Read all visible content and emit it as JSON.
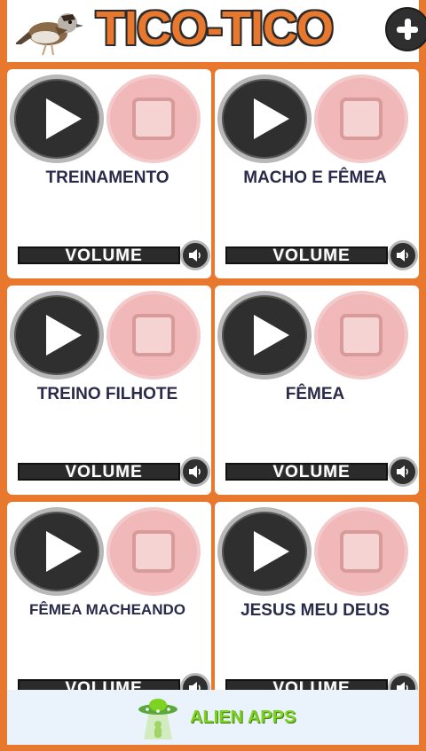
{
  "header": {
    "title": "TICO-TICO",
    "add_icon": "plus-icon",
    "logo_icon": "bird-icon"
  },
  "cards": [
    {
      "label": "TREINAMENTO",
      "volume_label": "VOLUME"
    },
    {
      "label": "MACHO E FÊMEA",
      "volume_label": "VOLUME"
    },
    {
      "label": "TREINO FILHOTE",
      "volume_label": "VOLUME"
    },
    {
      "label": "FÊMEA",
      "volume_label": "VOLUME"
    },
    {
      "label": "FÊMEA MACHEANDO",
      "volume_label": "VOLUME"
    },
    {
      "label": "JESUS MEU DEUS",
      "volume_label": "VOLUME"
    }
  ],
  "footer": {
    "brand": "ALIEN APPS"
  },
  "colors": {
    "accent": "#e9782f",
    "dark": "#2f2f2f",
    "stop": "#f0b8b8",
    "brand_green": "#7ed321"
  }
}
